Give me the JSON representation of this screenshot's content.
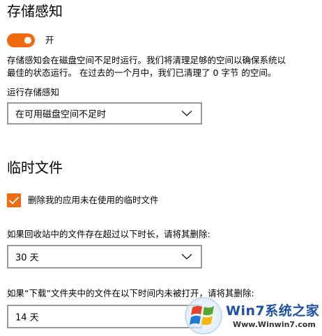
{
  "storage_sense": {
    "title": "存储感知",
    "toggle_state": "on",
    "toggle_label": "开",
    "description_line1": "存储感知会在磁盘空间不足时运行。我们将清理足够的空间以确保系统以",
    "description_line2": "最佳的状态运行。 在过去的一个月中，我们已清理了 0 字节 的空间。",
    "run_label": "运行存储感知",
    "run_value": "在可用磁盘空间不足时"
  },
  "temp_files": {
    "title": "临时文件",
    "delete_app_temp_checked": true,
    "delete_app_temp_label": "删除我的应用未在使用的临时文件",
    "recycle_label": "如果回收站中的文件存在超过以下时长，请将其删除:",
    "recycle_value": "30 天",
    "downloads_label": "如果“下载”文件夹中的文件在以下时间内未被打开，请将其删除:",
    "downloads_value": "14 天"
  },
  "watermark": {
    "title": "Win7系统之家",
    "url": "Www.Winwin7.com"
  },
  "colors": {
    "accent": "#f06a12",
    "dropdown_border": "#999999"
  },
  "icons": {
    "chevron": "chevron-down-icon",
    "check": "checkmark-icon",
    "logo": "windows-flag-logo"
  }
}
